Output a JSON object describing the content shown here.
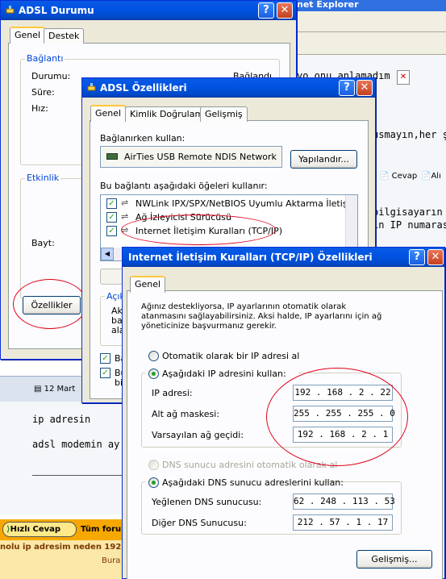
{
  "background": {
    "ie_title_fragment": "net Explorer",
    "line1": "yo onu anlamadım",
    "line2": "usmayın,her ş",
    "toolbar_reply": "Cevap",
    "toolbar_ali": "Alı",
    "line3": "bilgisayarın",
    "line4": "in IP numaras",
    "post_date": "12 Mart",
    "post_text1": "ip adresin",
    "post_text2": "adsl modemin ay",
    "quick_reply_label": "Hızlı Cevap",
    "forum_text": "Tüm foru",
    "bottom_text": "nolu ip adresim neden 192.",
    "bottom_text2": "Bura"
  },
  "adsl_status": {
    "title": "ADSL Durumu",
    "tabs": [
      "Genel",
      "Destek"
    ],
    "group_connection": "Bağlantı",
    "status_label": "Durumu:",
    "status_value": "Bağlandı",
    "duration_label": "Süre:",
    "speed_label": "Hız:",
    "group_activity": "Etkinlik",
    "bytes_label": "Bayt:",
    "properties_button": "Özellikler"
  },
  "adsl_props": {
    "title": "ADSL Özellikleri",
    "tabs": [
      "Genel",
      "Kimlik Doğrulama",
      "Gelişmiş"
    ],
    "connect_using_label": "Bağlanırken kullan:",
    "adapter": "AirTies USB Remote NDIS Network",
    "configure_button": "Yapılandır...",
    "items_label": "Bu bağlantı aşağıdaki öğeleri kullanır:",
    "items": [
      "NWLink IPX/SPX/NetBIOS Uyumlu Aktarma İletişim Kı",
      "Ağ İzleyicisi Sürücüsü",
      "Internet İletişim Kuralları (TCP/IP)"
    ],
    "desc_title": "Açıkl",
    "desc_lines": [
      "Akı",
      "bağ",
      "ala"
    ],
    "check1": "Ba",
    "check2_lines": [
      "Bu",
      "bilı"
    ]
  },
  "tcpip": {
    "title": "Internet İletişim Kuralları (TCP/IP) Özellikleri",
    "tab": "Genel",
    "description": "Ağınız destekliyorsa, IP ayarlarının otomatik olarak atanmasını sağlayabilirsiniz. Aksi halde, IP ayarlarını için ağ yöneticinize başvurmanız gerekir.",
    "radio_auto_ip": "Otomatik olarak bir IP adresi al",
    "radio_manual_ip": "Aşağıdaki IP adresini kullan:",
    "ip_label": "IP adresi:",
    "ip_value": "192 .  168 .    2   .   22",
    "mask_label": "Alt ağ maskesi:",
    "mask_value": "255 .  255 .  255 .    0",
    "gateway_label": "Varsayılan ağ geçidi:",
    "gateway_value": "192 .  168 .    2   .    1",
    "radio_auto_dns": "DNS sunucu adresini otomatik olarak al",
    "radio_manual_dns": "Aşağıdaki DNS sunucu adreslerini kullan:",
    "pref_dns_label": "Yeğlenen DNS sunucusu:",
    "pref_dns_value": "62  .  248 .  113 .  53",
    "alt_dns_label": "Diğer DNS Sunucusu:",
    "alt_dns_value": "212 .   57  .    1   .   17",
    "advanced_button": "Gelişmiş..."
  },
  "colors": {
    "highlight_ellipse": "#e0001a",
    "xp_blue": "#0054e3",
    "quick_reply_bar": "#f7a800"
  }
}
